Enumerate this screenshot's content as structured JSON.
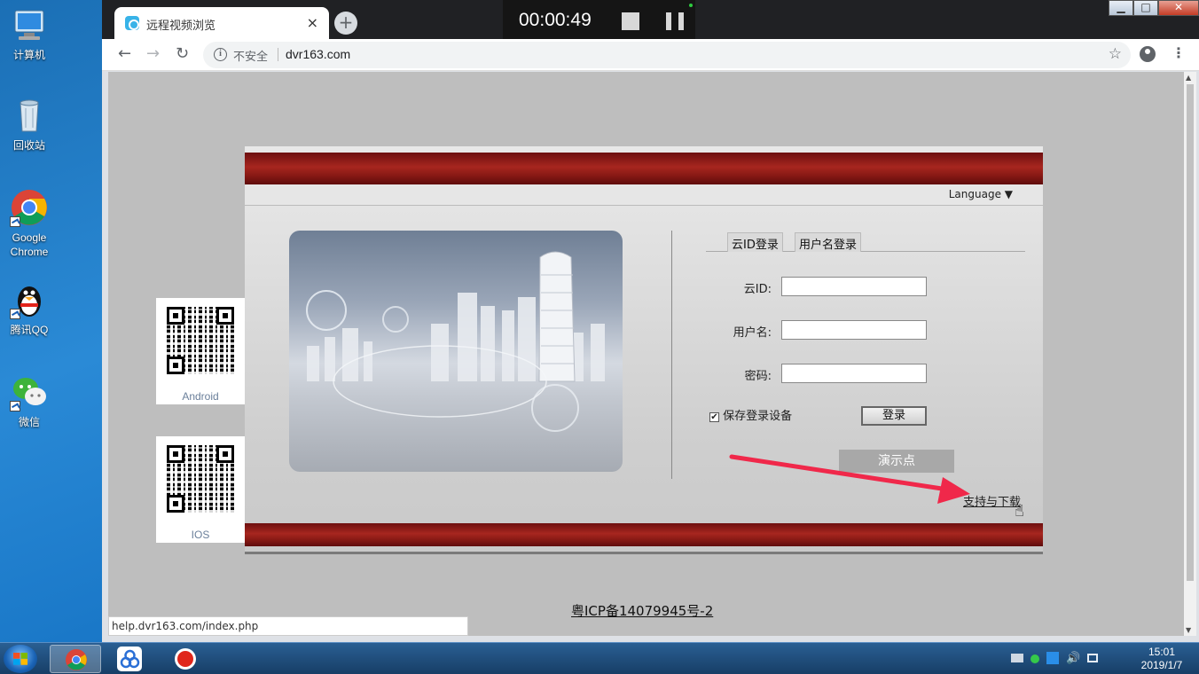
{
  "desktop": {
    "icons": [
      {
        "label": "计算机"
      },
      {
        "label": "回收站"
      },
      {
        "label": "Google Chrome"
      },
      {
        "label": "腾讯QQ"
      },
      {
        "label": "微信"
      }
    ]
  },
  "recorder": {
    "time": "00:00:49"
  },
  "browser": {
    "tab_title": "远程视频浏览",
    "tab_close": "×",
    "new_tab": "+",
    "security_label": "不安全",
    "url": "dvr163.com",
    "status_url": "help.dvr163.com/index.php"
  },
  "page": {
    "language": "Language ▼",
    "tabs": [
      "云ID登录",
      "用户名登录"
    ],
    "fields": {
      "cloud_id_label": "云ID:",
      "username_label": "用户名:",
      "password_label": "密码:"
    },
    "remember": "保存登录设备",
    "remember_check": "✔",
    "login_button": "登录",
    "demo_button": "演示点",
    "support_link": "支持与下载",
    "qr_android": "Android",
    "qr_ios": "IOS",
    "icp": "粤ICP备14079945号-2"
  },
  "taskbar": {
    "time": "15:01",
    "date": "2019/1/7"
  },
  "colors": {
    "band_red": "#a7261f",
    "annotation_arrow": "#f0284a"
  }
}
